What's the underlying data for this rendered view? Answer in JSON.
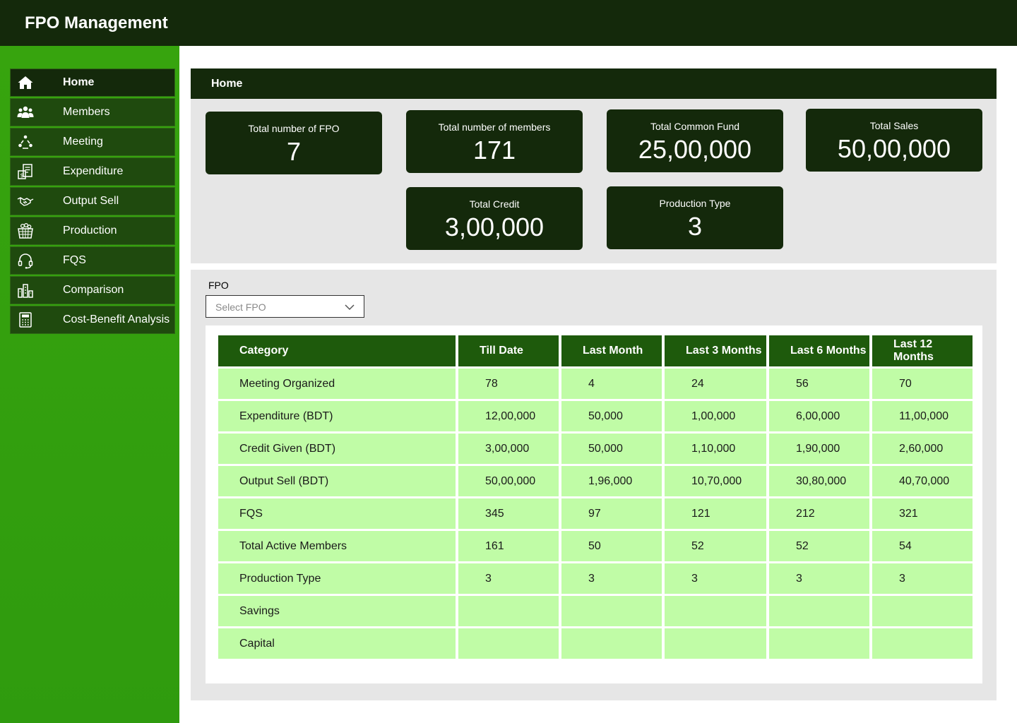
{
  "app": {
    "title": "FPO Management"
  },
  "sidebar": {
    "items": [
      {
        "label": "Home",
        "icon": "home-icon"
      },
      {
        "label": "Members",
        "icon": "members-icon"
      },
      {
        "label": "Meeting",
        "icon": "meeting-icon"
      },
      {
        "label": "Expenditure",
        "icon": "expenditure-icon"
      },
      {
        "label": "Output Sell",
        "icon": "handshake-icon"
      },
      {
        "label": "Production",
        "icon": "production-basket-icon"
      },
      {
        "label": "FQS",
        "icon": "headset-icon"
      },
      {
        "label": "Comparison",
        "icon": "comparison-buildings-icon"
      },
      {
        "label": "Cost-Benefit Analysis",
        "icon": "calculator-icon"
      }
    ]
  },
  "main": {
    "header": "Home",
    "stats": [
      {
        "label": "Total number of FPO",
        "value": "7"
      },
      {
        "label": "Total number of members",
        "value": "171"
      },
      {
        "label": "Total Common Fund",
        "value": "25,00,000"
      },
      {
        "label": "Total Sales",
        "value": "50,00,000"
      },
      {
        "label": "Total Credit",
        "value": "3,00,000"
      },
      {
        "label": "Production Type",
        "value": "3"
      }
    ],
    "filter": {
      "label": "FPO",
      "placeholder": "Select FPO"
    },
    "table": {
      "headers": [
        "Category",
        "Till Date",
        "Last Month",
        "Last 3 Months",
        "Last 6 Months",
        "Last 12 Months"
      ],
      "rows": [
        [
          "Meeting Organized",
          "78",
          "4",
          "24",
          "56",
          "70"
        ],
        [
          "Expenditure (BDT)",
          "12,00,000",
          "50,000",
          "1,00,000",
          "6,00,000",
          "11,00,000"
        ],
        [
          "Credit Given (BDT)",
          "3,00,000",
          "50,000",
          "1,10,000",
          "1,90,000",
          "2,60,000"
        ],
        [
          "Output Sell (BDT)",
          "50,00,000",
          "1,96,000",
          "10,70,000",
          "30,80,000",
          "40,70,000"
        ],
        [
          "FQS",
          "345",
          "97",
          "121",
          "212",
          "321"
        ],
        [
          "Total Active Members",
          "161",
          "50",
          "52",
          "52",
          "54"
        ],
        [
          "Production Type",
          "3",
          "3",
          "3",
          "3",
          "3"
        ],
        [
          "Savings",
          "",
          "",
          "",
          "",
          ""
        ],
        [
          "Capital",
          "",
          "",
          "",
          "",
          ""
        ]
      ]
    }
  },
  "colors": {
    "topbar": "#14290b",
    "sidebar": "#37a40e",
    "nav_item": "#1f4a0e",
    "card": "#14290b",
    "table_header": "#1e5a0c",
    "table_cell": "#c0fca6",
    "panel": "#e6e6e6"
  }
}
